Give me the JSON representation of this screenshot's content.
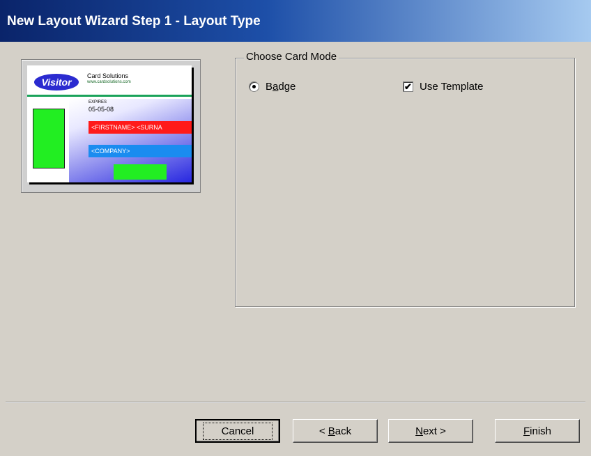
{
  "window": {
    "title": "New Layout Wizard Step 1 - Layout Type"
  },
  "preview": {
    "logo_text": "Visitor",
    "company": "Card Solutions",
    "website": "www.cardsolutions.com",
    "date_label": "EXPIRES",
    "date": "05-05-08",
    "name_field": "<FIRSTNAME> <SURNA",
    "company_field": "<COMPANY>"
  },
  "card_mode": {
    "legend": "Choose Card Mode",
    "badge_label": "Badge",
    "badge_selected": true,
    "use_template_label": "Use Template",
    "use_template_checked": true
  },
  "buttons": {
    "cancel": "Cancel",
    "back": "< Back",
    "next": "Next >",
    "finish": "Finish"
  },
  "colors": {
    "title_start": "#0a246a",
    "title_end": "#a6caf0",
    "dialog_bg": "#d4d0c8"
  }
}
